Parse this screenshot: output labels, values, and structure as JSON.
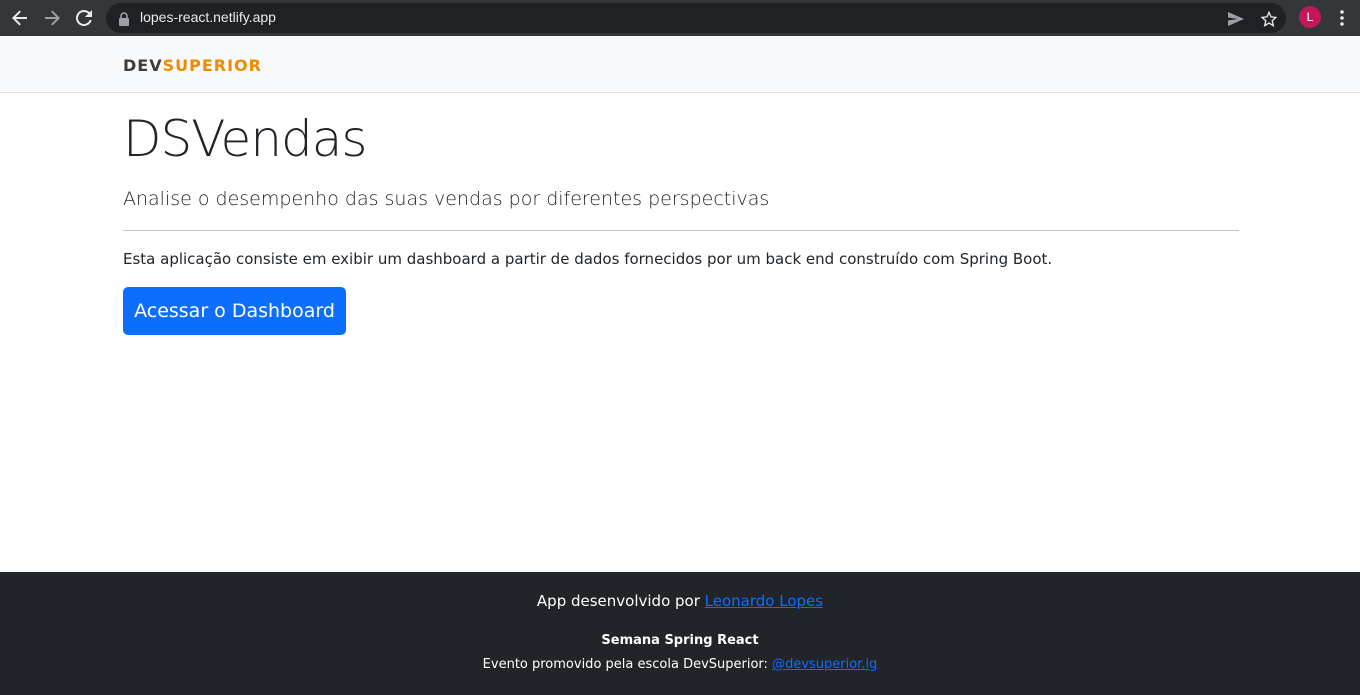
{
  "browser": {
    "url": "lopes-react.netlify.app",
    "profile_initial": "L",
    "icons": [
      "back-arrow-icon",
      "forward-arrow-icon",
      "reload-icon",
      "lock-icon",
      "send-icon",
      "star-icon",
      "kebab-menu-icon"
    ]
  },
  "header": {
    "logo_dev": "DEV",
    "logo_superior": "SUPERIOR",
    "logo_colors": {
      "dev": "#3c3c3c",
      "superior": "#f08a00"
    }
  },
  "main": {
    "title": "DSVendas",
    "lead": "Analise o desempenho das suas vendas por diferentes perspectivas",
    "description": "Esta aplicação consiste em exibir um dashboard a partir de dados fornecidos por um back end construído com Spring Boot.",
    "cta_label": "Acessar o Dashboard",
    "cta_color": "#0d6efd"
  },
  "footer": {
    "developed_by_prefix": "App desenvolvido por ",
    "developer_name": "Leonardo Lopes",
    "event_title": "Semana Spring React",
    "event_prefix": "Evento promovido pela escola DevSuperior: ",
    "event_handle": "@devsuperior.ig",
    "background": "#212529",
    "link_color": "#0d6efd"
  }
}
